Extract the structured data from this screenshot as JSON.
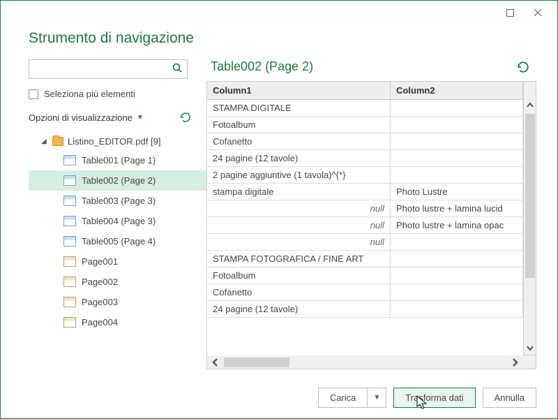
{
  "title": "Strumento di navigazione",
  "sidebar": {
    "multi_select_label": "Seleziona più elementi",
    "display_options_label": "Opzioni di visualizzazione",
    "folder_label": "Listino_EDITOR.pdf [9]",
    "items": [
      {
        "label": "Table001 (Page 1)",
        "kind": "table",
        "selected": false
      },
      {
        "label": "Table002 (Page 2)",
        "kind": "table",
        "selected": true
      },
      {
        "label": "Table003 (Page 3)",
        "kind": "table",
        "selected": false
      },
      {
        "label": "Table004 (Page 3)",
        "kind": "table",
        "selected": false
      },
      {
        "label": "Table005 (Page 4)",
        "kind": "table",
        "selected": false
      },
      {
        "label": "Page001",
        "kind": "sheet",
        "selected": false
      },
      {
        "label": "Page002",
        "kind": "sheet",
        "selected": false
      },
      {
        "label": "Page003",
        "kind": "sheet",
        "selected": false
      },
      {
        "label": "Page004",
        "kind": "sheet",
        "selected": false
      }
    ]
  },
  "preview": {
    "title": "Table002 (Page 2)",
    "columns": [
      "Column1",
      "Column2"
    ],
    "rows": [
      {
        "c1": "STAMPA DIGITALE",
        "c2": ""
      },
      {
        "c1": "Fotoalbum",
        "c2": ""
      },
      {
        "c1": "Cofanetto",
        "c2": ""
      },
      {
        "c1": "24 pagine (12 tavole)",
        "c2": ""
      },
      {
        "c1": "2 pagine aggiuntive (1 tavola)^{*}",
        "c2": ""
      },
      {
        "c1": "stampa digitale",
        "c2": "Photo Lustre"
      },
      {
        "c1": null,
        "c2": "Photo lustre + lamina lucid"
      },
      {
        "c1": null,
        "c2": "Photo lustre + lamina opac"
      },
      {
        "c1": null,
        "c2": ""
      },
      {
        "c1": "STAMPA FOTOGRAFICA / FINE ART",
        "c2": ""
      },
      {
        "c1": "Fotoalbum",
        "c2": ""
      },
      {
        "c1": "Cofanetto",
        "c2": ""
      },
      {
        "c1": "24 pagine (12 tavole)",
        "c2": ""
      }
    ]
  },
  "footer": {
    "load": "Carica",
    "transform": "Trasforma dati",
    "cancel": "Annulla"
  }
}
